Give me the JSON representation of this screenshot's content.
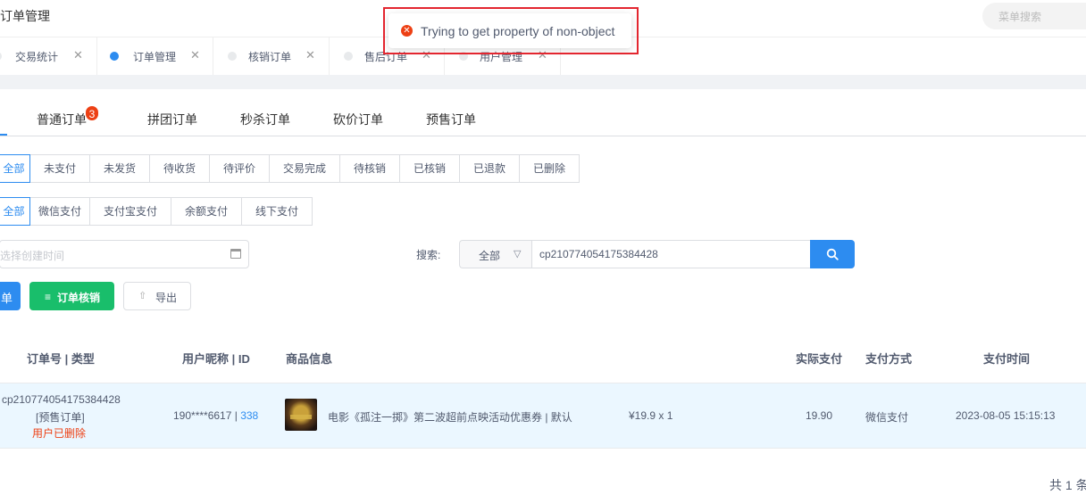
{
  "header": {
    "title": "订单管理",
    "menu_search_placeholder": "菜单搜索"
  },
  "error_toast": {
    "icon": "error-icon",
    "message": "Trying to get property of non-object"
  },
  "page_tabs": [
    {
      "label": "交易统计",
      "active": false
    },
    {
      "label": "订单管理",
      "active": true
    },
    {
      "label": "核销订单",
      "active": false
    },
    {
      "label": "售后订单",
      "active": false
    },
    {
      "label": "用户管理",
      "active": false
    }
  ],
  "order_types": {
    "tabs": [
      "普通订单",
      "拼团订单",
      "秒杀订单",
      "砍价订单",
      "预售订单"
    ],
    "badge_count": "3"
  },
  "status_filter": {
    "options": [
      "全部",
      "未支付",
      "未发货",
      "待收货",
      "待评价",
      "交易完成",
      "待核销",
      "已核销",
      "已退款",
      "已删除"
    ],
    "selected": "全部"
  },
  "payment_filter": {
    "options": [
      "全部",
      "微信支付",
      "支付宝支付",
      "余额支付",
      "线下支付"
    ],
    "selected": "全部"
  },
  "date_picker": {
    "placeholder": "选择创建时间",
    "icon": "calendar-icon"
  },
  "search": {
    "label": "搜索:",
    "field_value": "全部",
    "query": "cp210774054175384428",
    "button_icon": "search-icon"
  },
  "actions": {
    "partial_button_label": "单",
    "verify_button": "订单核销",
    "export_button": "导出"
  },
  "table": {
    "headers": [
      "订单号 | 类型",
      "用户昵称 | ID",
      "商品信息",
      "实际支付",
      "支付方式",
      "支付时间"
    ],
    "rows": [
      {
        "order_no": "cp210774054175384428",
        "order_type": "[预售订单]",
        "order_status": "用户已删除",
        "user_nick": "190****6617 | ",
        "user_id": "338",
        "product_name": "电影《孤注一掷》第二波超前点映活动优惠券 | 默认",
        "product_price": "¥19.9 x 1",
        "paid": "19.90",
        "pay_method": "微信支付",
        "pay_time": "2023-08-05 15:15:13"
      }
    ]
  },
  "pagination": {
    "total_text": "共 1 条"
  },
  "colors": {
    "primary": "#2d8cf0",
    "success": "#19be6b",
    "error": "#ed4014",
    "row_highlight": "#ebf7ff",
    "annotation_frame": "#e3262f"
  }
}
